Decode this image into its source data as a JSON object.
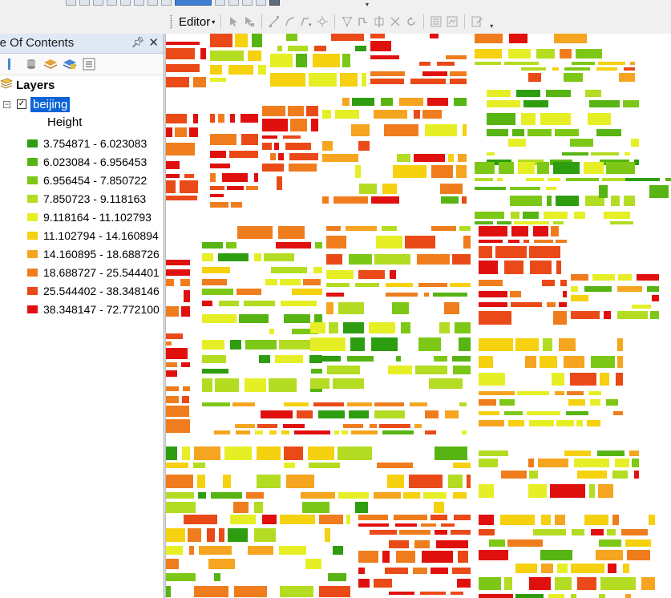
{
  "editor_toolbar": {
    "editor_label": "Editor"
  },
  "toc": {
    "title": "ble Of Contents",
    "layers_label": "Layers",
    "layer": {
      "name": "beijing",
      "checked": true,
      "field": "Height"
    },
    "legend": [
      {
        "label": "3.754871 - 6.023083",
        "color": "#2e9e10"
      },
      {
        "label": "6.023084 - 6.956453",
        "color": "#57b412"
      },
      {
        "label": "6.956454 - 7.850722",
        "color": "#7dc816"
      },
      {
        "label": "7.850723 - 9.118163",
        "color": "#b3dc22"
      },
      {
        "label": "9.118164 - 11.102793",
        "color": "#e6ef25"
      },
      {
        "label": "11.102794 - 14.160894",
        "color": "#f5d10f"
      },
      {
        "label": "14.160895 - 18.688726",
        "color": "#f5a51f"
      },
      {
        "label": "18.688727 - 25.544401",
        "color": "#ef7d1e"
      },
      {
        "label": "25.544402 - 38.348146",
        "color": "#ea4a17"
      },
      {
        "label": "38.348147 - 72.772100",
        "color": "#e0100f"
      }
    ]
  },
  "icons": {
    "toc_pin": "pin-icon",
    "toc_close": "close-icon",
    "layers": "layers-icon"
  }
}
